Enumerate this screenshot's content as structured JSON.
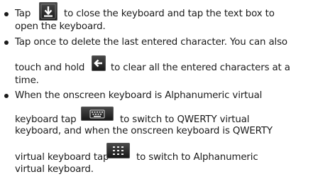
{
  "bullets": [
    {
      "lines": [
        {
          "pre": "Tap",
          "post": "to close the keyboard and tap the text box to"
        },
        {
          "text": "open the keyboard."
        }
      ],
      "icon": "keyboard-hide-icon"
    },
    {
      "lines": [
        {
          "text": "Tap once to delete the last entered character. You can also"
        },
        {
          "pre": "touch and hold",
          "post": "to clear all the entered characters at a"
        },
        {
          "text": "time."
        }
      ],
      "icon": "backspace-arrow-icon"
    },
    {
      "lines": [
        {
          "text": "When the onscreen keyboard is Alphanumeric virtual"
        },
        {
          "pre": "keyboard tap",
          "post": "to switch to QWERTY virtual"
        },
        {
          "text": "keyboard, and when the onscreen keyboard is QWERTY"
        },
        {
          "pre": "virtual keyboard tap",
          "post": "to switch to Alphanumeric"
        },
        {
          "text": "virtual keyboard."
        }
      ],
      "icons": [
        "qwerty-keyboard-icon",
        "alphanumeric-keypad-icon"
      ]
    }
  ],
  "colors": {
    "text": "#1a1a1a",
    "icon_background": "#2a2a2a",
    "icon_symbol": "#ffffff"
  }
}
